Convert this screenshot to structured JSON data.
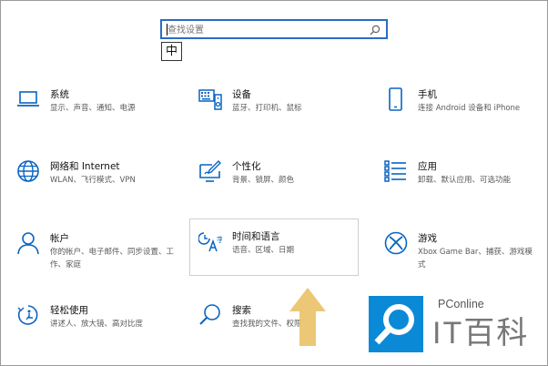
{
  "search": {
    "placeholder": "查找设置"
  },
  "ime": "中",
  "tiles": [
    {
      "title": "系统",
      "desc": "显示、声音、通知、电源",
      "icon": "laptop-icon"
    },
    {
      "title": "设备",
      "desc": "蓝牙、打印机、鼠标",
      "icon": "keyboard-speaker-icon"
    },
    {
      "title": "手机",
      "desc": "连接 Android 设备和 iPhone",
      "icon": "phone-icon"
    },
    {
      "title": "网络和 Internet",
      "desc": "WLAN、飞行模式、VPN",
      "icon": "globe-icon"
    },
    {
      "title": "个性化",
      "desc": "背景、锁屏、颜色",
      "icon": "paint-monitor-icon"
    },
    {
      "title": "应用",
      "desc": "卸载、默认应用、可选功能",
      "icon": "apps-list-icon"
    },
    {
      "title": "帐户",
      "desc": "你的帐户、电子邮件、同步设置、工作、家庭",
      "icon": "person-icon"
    },
    {
      "title": "时间和语言",
      "desc": "语音、区域、日期",
      "icon": "time-language-icon"
    },
    {
      "title": "游戏",
      "desc": "Xbox Game Bar、捕获、游戏模式",
      "icon": "xbox-icon"
    },
    {
      "title": "轻松使用",
      "desc": "讲述人、放大镜、高对比度",
      "icon": "ease-of-access-icon"
    },
    {
      "title": "搜索",
      "desc": "查找我的文件、权限",
      "icon": "magnifier-icon"
    }
  ],
  "watermark": {
    "brand": "PConline",
    "name": "IT百科",
    "icon": "search-logo-icon"
  },
  "colors": {
    "accent": "#0a64c2",
    "arrow": "#e9c26a"
  }
}
